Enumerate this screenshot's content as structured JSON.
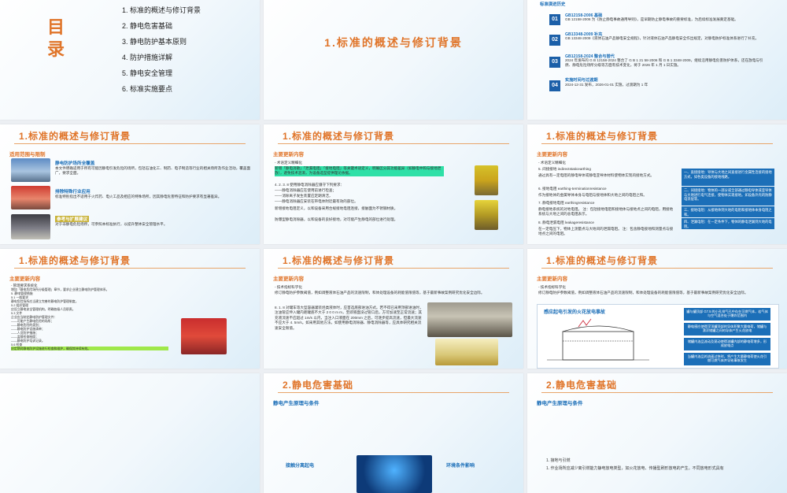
{
  "s1": {
    "label": "目录",
    "items": [
      "1. 标准的概述与修订背景",
      "2. 静电危害基础",
      "3. 静电防护基本原则",
      "4. 防护措施详解",
      "5. 静电安全管理",
      "6. 标准实施要点"
    ]
  },
  "s2": {
    "title": "1.标准的概述与修订背景"
  },
  "s3": {
    "heading": "标准演进历史",
    "entries": [
      {
        "num": "01",
        "title": "GB12158-2006 基础",
        "body": "GB 12158-2006 为《防止静电事故通用导则》，是早期防止静电事故的重要标准，为后续标准发展奠定基础。"
      },
      {
        "num": "02",
        "title": "GB13348-2009 补充",
        "body": "GB 13348-2009《液体石油产品静电安全规程》，针对液体石油产品静电安全作出规定，对静电防护标准体系进行了补充。"
      },
      {
        "num": "03",
        "title": "GB12158-2024 整合与替代",
        "body": "2024 年发布的 G B 12158-2024 整合了 G B 1 21 58-2006 和 G B 1 3348-2009，继续沿用静电危害防护体系，还在放电与引燃、静电危险场所分级等方面有技术变化，将于 2026 年 1 月 1 日实施。"
      },
      {
        "num": "04",
        "title": "实施时间与过渡期",
        "body": "2024-12-31 发布，2026-01-01 实施，过渡期为 1 年"
      }
    ]
  },
  "s4": {
    "title": "1.标准的概述与修订背景",
    "section": "适用范围与限制",
    "cards": [
      {
        "title": "静电防护场所全覆盖",
        "body": "本文件明确适用于所有可能因静电引发危险的场所，包括石油化工、制药、电子制造等行业的相关场所及作业活动，覆盖面广，要求全面。"
      },
      {
        "title": "排除特殊行业应用",
        "body": "标准特别指出不适用于火炸药、电火工品及相应的特殊场所，因其静电危害特征和防护要求有显著差异。"
      },
      {
        "title": "参考与扩展建议",
        "body": "对于非静电危险场所，可参照本标准执行，以提升整体安全管理水平。"
      }
    ]
  },
  "s5": {
    "title": "1.标准的概述与修订背景",
    "section": "主要更新内容",
    "body": [
      "- 术语定义精细化",
      "新增「静电消散」「泄漏电阻」「接地电阻」等关键术语定义，明确区分其功能差异（如静电中和与接地泄放），避免技术混淆，为设备选型提供理论依据。",
      "4. 2. 3. 8 使用静电消除器应遵守下列要求：",
      "——静电消除器应在使用前进行检查；",
      "——消除离子发生装置应定期清洁，",
      "——静电消除器应安装在带电体附近最有效的部位。",
      "新增接地电阻定义，以和设备采用合规接地电阻连接，接触面为不锈钢材质。",
      "防爆型静电消除器，以和设备的良好接地，对可能产生静电的部位进行处理。"
    ]
  },
  "s6": {
    "title": "1.标准的概述与修订背景",
    "section": "主要更新内容",
    "body": [
      "- 术语定义精细化",
      "5. 间接接地 indirectstaticearthing",
      "通过具有一定电阻的静电导体或静电亚导体材料使物体实现的接地方式。",
      "6. 接地电阻 earthing-terminationresistance",
      "作为接地体的金属导体本身与电阻与接地体和大地之间的电阻之和。",
      "7. 静电接地电阻 earthingresistance",
      "静电接地系统的对地电阻。 注：包括接地电阻和接地体与接地点之间的电阻，用接地系统与大地之间的总电阻表示。",
      "8. 静电泄漏电阻 leakageresistance",
      "在一定电压下，物体上测量点与大地间的泄漏电阻。 注：包含静电接地和测量点与接地点之间的电阻。"
    ],
    "boxes": [
      "一、直接接地：导体与大地之间直接进行金属性连接的接地方式，如各类设备的接地线路。",
      "二、间接接地：物体的一部分或全部通过静电导体或亚导体与大地进行电气连接，使物体实现接地。如设备外壳的防静电涂层等。",
      "三、接地电阻：从接地体到大地的电阻和接地体本身电阻之和。",
      "四、泄漏电阻：在一定条件下，物体的静电泄漏到大地的电阻。"
    ]
  },
  "s7": {
    "title": "1.标准的概述与修订背景",
    "section": "主要更新内容",
    "body": [
      "- 管理要求系统化",
      "增加「静电危险场所分级管理」章节，要求企业建立静电防护管理体系。",
      "5. 静电管理措施",
      "5.1 一般要求",
      "静电危险场所应当建立完善的静电防护管理制度。",
      "5.2 组织管理",
      "应设立静电安全管理机构，明确各级人员职责。",
      "5.3 文件",
      "企业应当制定静电防护管理文件：",
      "——可能产生静电危险的场所；",
      "——静电危险的类别；",
      "——静电防护设施清单；",
      "——人员防护措施；",
      "——监督检查制度；",
      "——静电防护培训记录。",
      "5.6 检查",
      "应定期对静电防护设施进行检查和维护，确保其持续有效。"
    ]
  },
  "s8": {
    "title": "1.标准的概述与修订背景",
    "section": "主要更新内容",
    "body": [
      "- 技术指标科学化",
      "修订静电防护参数阈值，例如调整液体石油产品的流速限制，和体处理设备的耗能值限值等，基于最新事故案例研究优化安全边际。",
      "8. 1. 8 对罐车等大型容器灌装烃类液体时，应首选底部进油方式。若不得已采用顶部进油时，注油管应伸入罐内距罐底不大于 2 0 0 m m，至即液面没过管口后，方可加速至正常流速；其充液流速不应超过 1m/s 以内，当注入口液面在 200mm 之后，可逐步提高流速，但最大流速不应大于 4. 5m/s。如采用其他方法，如使用静电消除器、静电消除器等，应具体研究相关流速安全限值。"
    ]
  },
  "s9": {
    "title": "1.标准的概述与修订背景",
    "section": "主要更新内容",
    "body": [
      "- 技术指标科学化",
      "修订静电防护参数阈值，例如调整液体石油产品的流速限制，和体处理设备的耗能值限值等，基于最新事故案例研究优化安全边际。"
    ],
    "diagram_title": "感应起电引发的火花放电事故",
    "flow": [
      "罐与罐顶部 G7.5 的小孔排气孔中存在可燃气体，若气体与空气混合处于爆炸范围内",
      "静电感应使得浮顶罐顶部的导体积聚大量电荷，储罐与漂浮储罐之间的导体产生火花放电",
      "储罐内油品流动及晃动使得油罐内部的静电荷增多，形成放电点",
      "当罐内油品的流速过快时，将产生大量静电荷使火花引燃可燃气体并导致事故发生"
    ]
  },
  "s10": {},
  "s11": {
    "title": "2.静电危害基础",
    "section": "静电产生原理与条件",
    "cards": [
      "接触分离起电",
      "环境条件影响"
    ]
  },
  "s12": {
    "title": "2.静电危害基础",
    "section": "静电产生原理与条件",
    "body": [
      "1. 接地与引燃",
      "1. 作业场所应减少离引燃能力静电放电类型，如火花放电、传播型刷形放电的产生。不同放电形式具有"
    ]
  }
}
